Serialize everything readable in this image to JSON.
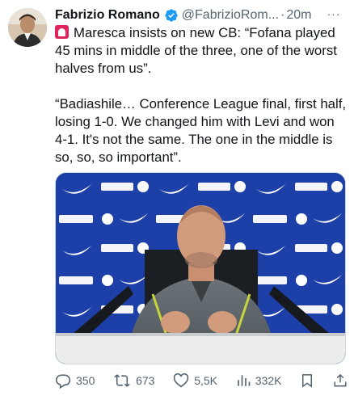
{
  "tweet": {
    "author": {
      "name": "Fabrizio Romano",
      "handle": "@FabrizioRom...",
      "verified": true
    },
    "separator": "·",
    "time": "20m",
    "more": "···",
    "text": {
      "line1": "Maresca insists on new CB: “Fofana played 45 mins in middle of the three, one of the worst halves from us”.",
      "line2": "“Badiashile… Conference League final, first half, losing 1-0. We changed him with Levi and won 4-1. It's not the same. The one in the middle is so, so, so important”."
    },
    "media": {
      "backdrop_words": [
        "BingX"
      ]
    },
    "stats": {
      "replies": "350",
      "reposts": "673",
      "likes": "5,5K",
      "views": "332K"
    }
  },
  "colors": {
    "text": "#0f1419",
    "secondary": "#536471",
    "verified": "#1d9bf0",
    "siren": "#e0245e",
    "backdrop_blue": "#1d3fa8"
  },
  "icons": [
    "siren-icon",
    "verified-badge-icon",
    "more-icon",
    "reply-icon",
    "repost-icon",
    "like-icon",
    "views-icon",
    "bookmark-icon",
    "share-icon"
  ]
}
